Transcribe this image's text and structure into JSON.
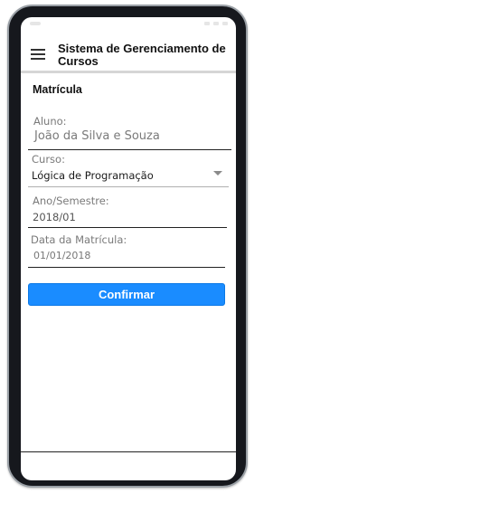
{
  "header": {
    "title": "Sistema de Gerenciamento de Cursos",
    "menu_icon": "hamburger-menu-icon"
  },
  "form": {
    "section_title": "Matrícula",
    "fields": {
      "aluno": {
        "label": "Aluno:",
        "value": "João da Silva e Souza"
      },
      "curso": {
        "label": "Curso:",
        "value": "Lógica de Programação",
        "icon": "dropdown-arrow-icon"
      },
      "ano_semestre": {
        "label": "Ano/Semestre:",
        "value": "2018/01"
      },
      "data_matricula": {
        "label": "Data da Matrícula:",
        "value": "01/01/2018"
      }
    },
    "confirm_label": "Confirmar"
  },
  "colors": {
    "primary_button": "#1a8cff",
    "frame": "#16181d",
    "label": "#7a7a7a"
  }
}
